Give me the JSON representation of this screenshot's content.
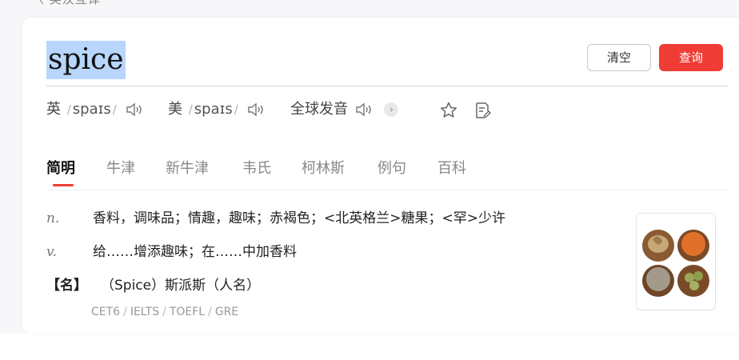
{
  "top_crumb": "〈  英汉互译",
  "search": {
    "query": "spice",
    "clear_label": "清空",
    "submit_label": "查询"
  },
  "pronunciations": [
    {
      "label": "英",
      "phonetic": "spaɪs",
      "icon": "speaker-icon"
    },
    {
      "label": "美",
      "phonetic": "spaɪs",
      "icon": "speaker-icon"
    },
    {
      "label": "全球发音",
      "icon": "speaker-icon",
      "more_icon": "chevron-right-icon"
    }
  ],
  "actions": {
    "favorite_icon": "star-icon",
    "note_icon": "note-edit-icon"
  },
  "tabs": [
    {
      "label": "简明",
      "active": true
    },
    {
      "label": "牛津",
      "active": false
    },
    {
      "label": "新牛津",
      "active": false
    },
    {
      "label": "韦氏",
      "active": false
    },
    {
      "label": "柯林斯",
      "active": false
    },
    {
      "label": "例句",
      "active": false
    },
    {
      "label": "百科",
      "active": false
    }
  ],
  "definitions": [
    {
      "pos": "n.",
      "text": "香料，调味品；情趣，趣味；赤褐色；<北英格兰>糖果；<罕>少许"
    },
    {
      "pos": "v.",
      "text": "给……增添趣味；在……中加香料"
    }
  ],
  "name_entry": {
    "tag": "【名】",
    "text": "（Spice）斯派斯（人名）"
  },
  "exams": [
    "CET6",
    "IELTS",
    "TOEFL",
    "GRE"
  ],
  "image": {
    "icon": "spice-bowls-image"
  },
  "colors": {
    "accent": "#f03c36",
    "selection": "#b8d5fb"
  }
}
